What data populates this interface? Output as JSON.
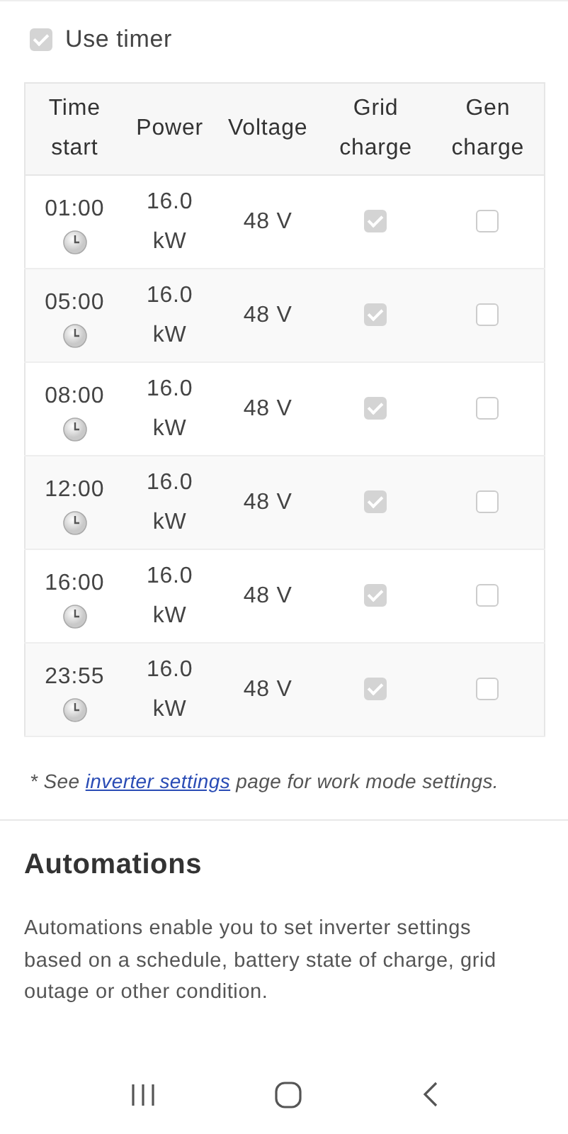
{
  "use_timer": {
    "label": "Use timer",
    "checked": true,
    "disabled": true
  },
  "table": {
    "disabled": true,
    "columns": [
      "Time start",
      "Power",
      "Voltage",
      "Grid charge",
      "Gen charge"
    ],
    "rows": [
      {
        "time": "01:00",
        "power": "16.0 kW",
        "voltage": "48 V",
        "grid_charge": true,
        "gen_charge": false
      },
      {
        "time": "05:00",
        "power": "16.0 kW",
        "voltage": "48 V",
        "grid_charge": true,
        "gen_charge": false
      },
      {
        "time": "08:00",
        "power": "16.0 kW",
        "voltage": "48 V",
        "grid_charge": true,
        "gen_charge": false
      },
      {
        "time": "12:00",
        "power": "16.0 kW",
        "voltage": "48 V",
        "grid_charge": true,
        "gen_charge": false
      },
      {
        "time": "16:00",
        "power": "16.0 kW",
        "voltage": "48 V",
        "grid_charge": true,
        "gen_charge": false
      },
      {
        "time": "23:55",
        "power": "16.0 kW",
        "voltage": "48 V",
        "grid_charge": true,
        "gen_charge": false
      }
    ]
  },
  "footnote": {
    "before": "* See",
    "link": "inverter settings",
    "after": "page for work mode settings."
  },
  "automations": {
    "title": "Automations",
    "description": "Automations enable you to set inverter settings based on a schedule, battery state of charge, grid outage or other condition."
  }
}
